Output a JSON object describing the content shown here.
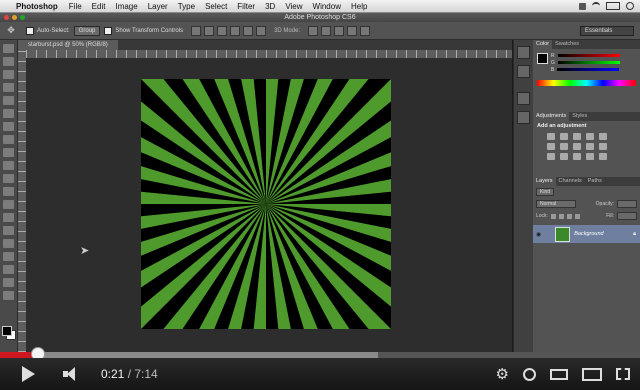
{
  "menubar": {
    "app_name": "Photoshop",
    "items": [
      "File",
      "Edit",
      "Image",
      "Layer",
      "Type",
      "Select",
      "Filter",
      "3D",
      "View",
      "Window",
      "Help"
    ]
  },
  "window": {
    "title": "Adobe Photoshop CS6"
  },
  "options_bar": {
    "auto_select_label": "Auto-Select:",
    "auto_select_value": "Group",
    "show_transform_label": "Show Transform Controls",
    "mode_label": "3D Mode:",
    "workspace": "Essentials"
  },
  "document": {
    "tab_title": "starburst.psd @ 50% (RGB/8)"
  },
  "artwork": {
    "colors": {
      "ray_a": "#000000",
      "ray_b": "#4e9a2c"
    },
    "ray_count": 64
  },
  "panels": {
    "color_tabs": [
      "Color",
      "Swatches"
    ],
    "sliders": [
      {
        "label": "R"
      },
      {
        "label": "G"
      },
      {
        "label": "B"
      }
    ],
    "adjustment_tabs": [
      "Adjustments",
      "Styles"
    ],
    "add_adjustment": "Add an adjustment",
    "layer_tabs": [
      "Layers",
      "Channels",
      "Paths"
    ],
    "kind_label": "Kind",
    "blend_mode": "Normal",
    "opacity_label": "Opacity:",
    "lock_label": "Lock:",
    "fill_label": "Fill:",
    "layer_name": "Background"
  },
  "player": {
    "current_time": "0:21",
    "separator": " / ",
    "duration": "7:14",
    "played_fraction": 0.06,
    "buffered_fraction": 0.59,
    "accent": "#cc181e"
  }
}
